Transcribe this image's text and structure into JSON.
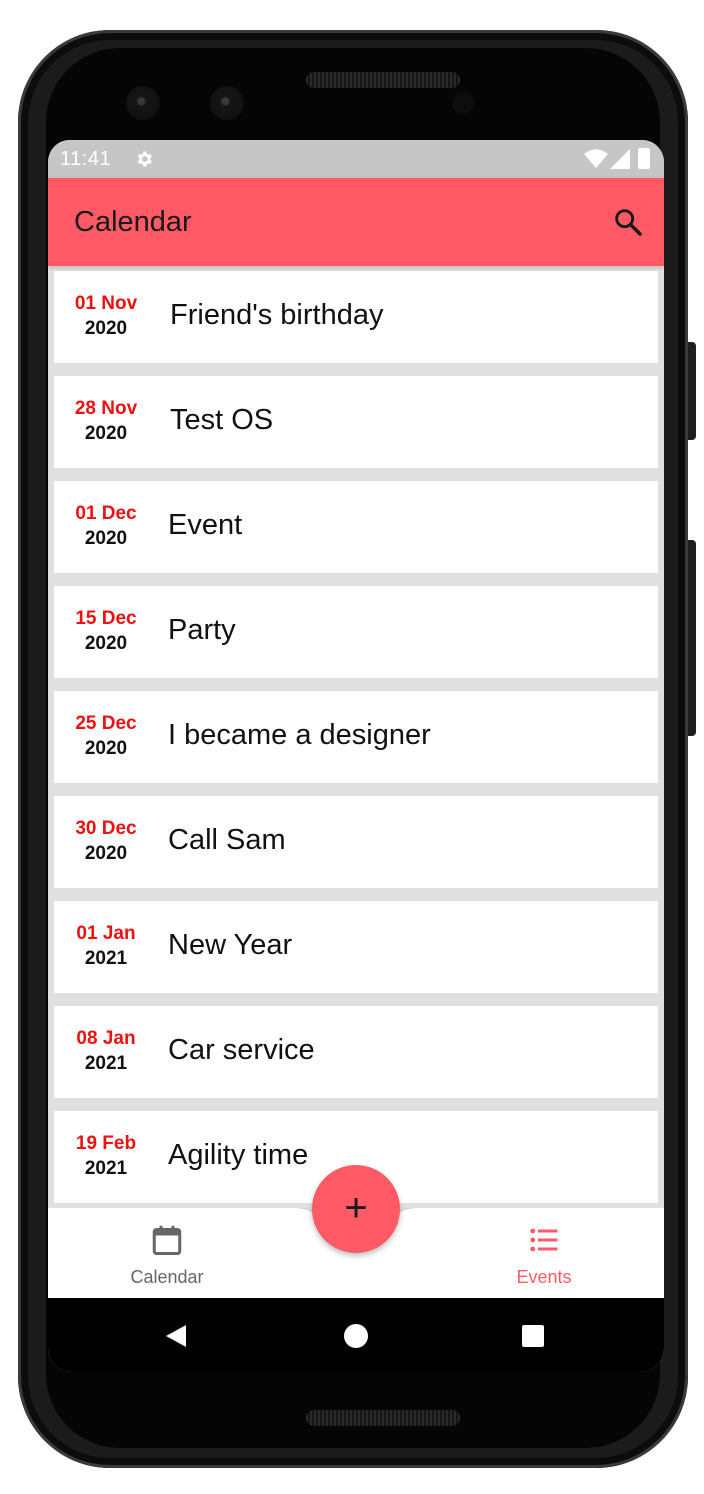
{
  "statusbar": {
    "time": "11:41",
    "icons": [
      "settings-gear-icon",
      "wifi-icon",
      "signal-icon",
      "battery-icon"
    ]
  },
  "appbar": {
    "title": "Calendar",
    "search_icon": "search-icon"
  },
  "events": [
    {
      "day": "01 Nov",
      "year": "2020",
      "title": "Friend's birthday"
    },
    {
      "day": "28 Nov",
      "year": "2020",
      "title": "Test OS"
    },
    {
      "day": "01 Dec",
      "year": "2020",
      "title": "Event"
    },
    {
      "day": "15 Dec",
      "year": "2020",
      "title": "Party"
    },
    {
      "day": "25 Dec",
      "year": "2020",
      "title": "I became a designer"
    },
    {
      "day": "30 Dec",
      "year": "2020",
      "title": "Call Sam"
    },
    {
      "day": "01 Jan",
      "year": "2021",
      "title": "New Year"
    },
    {
      "day": "08 Jan",
      "year": "2021",
      "title": "Car service"
    },
    {
      "day": "19 Feb",
      "year": "2021",
      "title": "Agility time"
    }
  ],
  "fab": {
    "label": "+",
    "icon": "add-icon"
  },
  "bottom_nav": {
    "calendar": {
      "label": "Calendar",
      "icon": "calendar-icon",
      "active": false
    },
    "events": {
      "label": "Events",
      "icon": "list-icon",
      "active": true
    }
  },
  "colors": {
    "accent": "#ff5a66",
    "date_day": "#ee1111",
    "inactive_nav": "#666666",
    "list_background": "#e0e0e0"
  }
}
